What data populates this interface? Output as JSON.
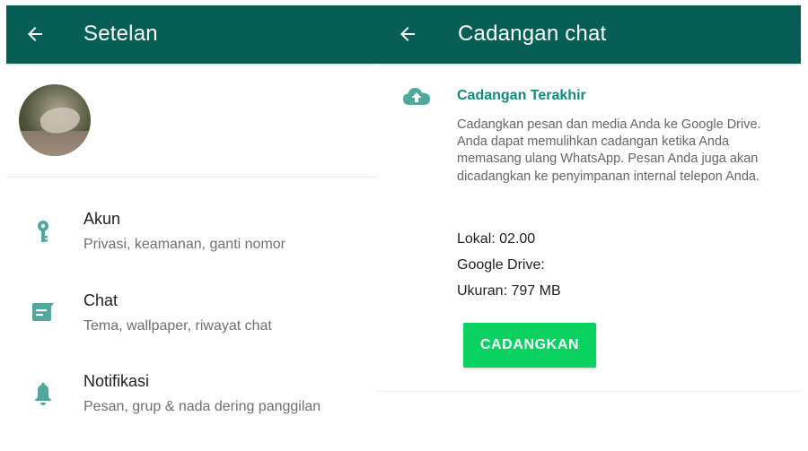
{
  "colors": {
    "appbar": "#075e54",
    "accent_text": "#118a7e",
    "icon_teal": "#4fa79d",
    "button": "#09d261"
  },
  "settings_screen": {
    "title": "Setelan",
    "back_icon": "arrow-back-icon",
    "items": [
      {
        "icon": "key-icon",
        "title": "Akun",
        "subtitle": "Privasi, keamanan, ganti nomor"
      },
      {
        "icon": "chat-icon",
        "title": "Chat",
        "subtitle": "Tema, wallpaper, riwayat chat"
      },
      {
        "icon": "bell-icon",
        "title": "Notifikasi",
        "subtitle": "Pesan, grup & nada dering panggilan"
      }
    ]
  },
  "backup_screen": {
    "title": "Cadangan chat",
    "back_icon": "arrow-back-icon",
    "section_icon": "cloud-upload-icon",
    "section_title": "Cadangan Terakhir",
    "description": "Cadangkan pesan dan media Anda ke Google Drive. Anda dapat memulihkan cadangan ketika Anda memasang ulang WhatsApp. Pesan Anda juga akan dicadangkan ke penyimpanan internal telepon Anda.",
    "local_label": "Lokal: 02.00",
    "drive_label": "Google Drive:",
    "size_label": "Ukuran: 797 MB",
    "backup_button": "CADANGKAN"
  }
}
